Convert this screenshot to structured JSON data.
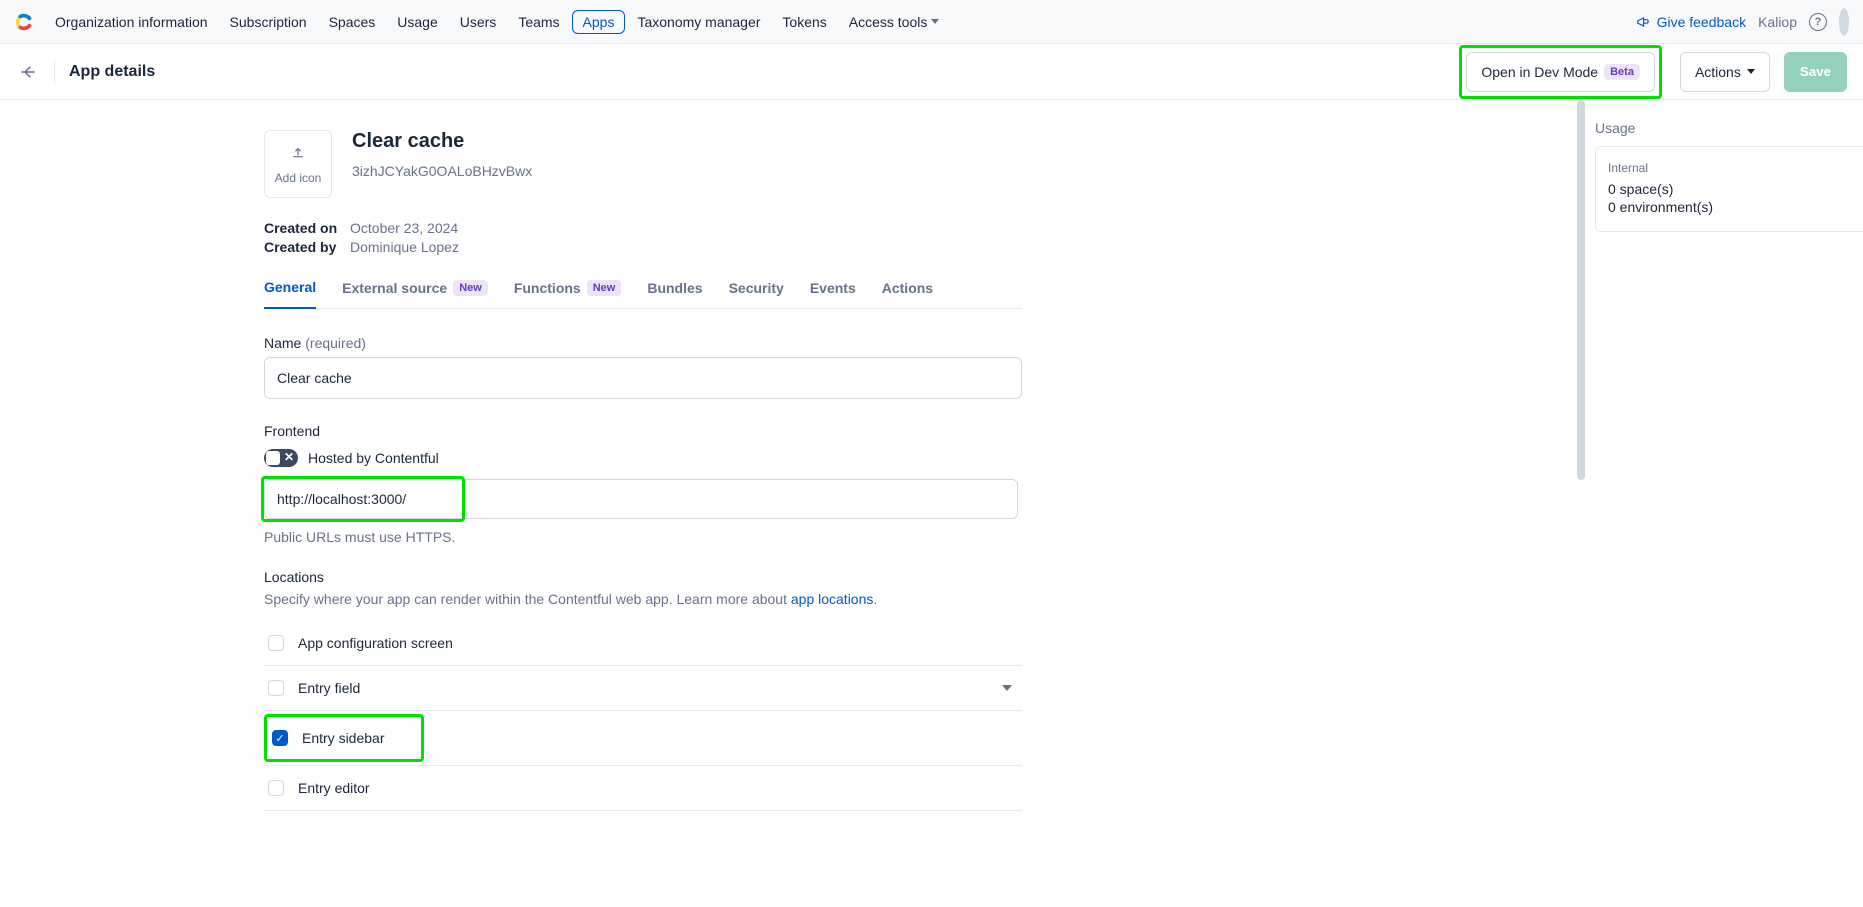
{
  "nav": {
    "items": [
      {
        "label": "Organization information"
      },
      {
        "label": "Subscription"
      },
      {
        "label": "Spaces"
      },
      {
        "label": "Usage"
      },
      {
        "label": "Users"
      },
      {
        "label": "Teams"
      },
      {
        "label": "Apps"
      },
      {
        "label": "Taxonomy manager"
      },
      {
        "label": "Tokens"
      },
      {
        "label": "Access tools"
      }
    ],
    "feedback": "Give feedback",
    "org": "Kaliop"
  },
  "subheader": {
    "title": "App details",
    "dev_mode": "Open in Dev Mode",
    "beta": "Beta",
    "actions": "Actions",
    "save": "Save"
  },
  "app": {
    "add_icon": "Add icon",
    "name": "Clear cache",
    "id": "3izhJCYakG0OALoBHzvBwx",
    "created_on_label": "Created on",
    "created_on": "October 23, 2024",
    "created_by_label": "Created by",
    "created_by": "Dominique Lopez"
  },
  "tabs": [
    {
      "label": "General",
      "active": true
    },
    {
      "label": "External source",
      "badge": "New"
    },
    {
      "label": "Functions",
      "badge": "New"
    },
    {
      "label": "Bundles"
    },
    {
      "label": "Security"
    },
    {
      "label": "Events"
    },
    {
      "label": "Actions"
    }
  ],
  "form": {
    "name_label": "Name",
    "required": "(required)",
    "name_value": "Clear cache",
    "frontend_label": "Frontend",
    "hosted_label": "Hosted by Contentful",
    "url_value": "http://localhost:3000/",
    "url_hint": "Public URLs must use HTTPS.",
    "locations_label": "Locations",
    "locations_desc_pre": "Specify where your app can render within the Contentful web app. Learn more about ",
    "locations_link": "app locations",
    "loc": [
      {
        "label": "App configuration screen",
        "checked": false
      },
      {
        "label": "Entry field",
        "checked": false,
        "expandable": true
      },
      {
        "label": "Entry sidebar",
        "checked": true,
        "highlight": true
      },
      {
        "label": "Entry editor",
        "checked": false
      }
    ]
  },
  "side": {
    "heading": "Usage",
    "internal": "Internal",
    "line1": "0 space(s)",
    "line2": "0 environment(s)"
  }
}
